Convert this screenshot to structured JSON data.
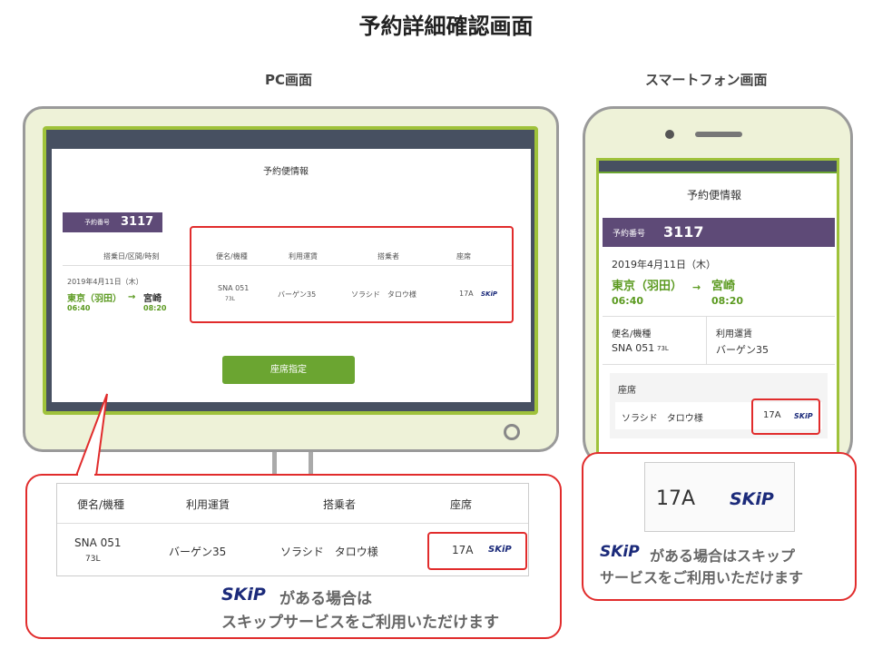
{
  "title": "予約詳細確認画面",
  "pc_heading": "PC画面",
  "sp_heading": "スマートフォン画面",
  "pc": {
    "screen_title": "予約便情報",
    "reservation_label": "予約番号",
    "reservation_number": "3117",
    "col_date": "搭乗日/区間/時刻",
    "col_flight": "便名/機種",
    "col_fare": "利用運賃",
    "col_passenger": "搭乗者",
    "col_seat": "座席",
    "date": "2019年4月11日（木）",
    "from": "東京（羽田）",
    "to": "宮崎",
    "dep_time": "06:40",
    "arr_time": "08:20",
    "flight": "SNA 051",
    "aircraft": "73L",
    "fare": "バーゲン35",
    "passenger": "ソラシド　タロウ様",
    "seat": "17A",
    "skip": "SKiP",
    "button": "座席指定"
  },
  "pc_zoom": {
    "col_flight": "便名/機種",
    "col_fare": "利用運賃",
    "col_passenger": "搭乗者",
    "col_seat": "座席",
    "flight": "SNA 051",
    "aircraft": "73L",
    "fare": "バーゲン35",
    "passenger": "ソラシド　タロウ様",
    "seat": "17A",
    "skip": "SKiP",
    "note_line1": "がある場合は",
    "note_line2": "スキップサービスをご利用いただけます"
  },
  "sp": {
    "screen_title": "予約便情報",
    "reservation_label": "予約番号",
    "reservation_number": "3117",
    "date": "2019年4月11日（木）",
    "from": "東京（羽田）",
    "to": "宮崎",
    "dep_time": "06:40",
    "arr_time": "08:20",
    "flight_label": "便名/機種",
    "flight": "SNA 051",
    "aircraft": "73L",
    "fare_label": "利用運賃",
    "fare": "バーゲン35",
    "seat_label": "座席",
    "passenger": "ソラシド　タロウ様",
    "seat": "17A",
    "skip": "SKiP"
  },
  "sp_zoom": {
    "seat": "17A",
    "skip": "SKiP",
    "note_line1": "がある場合はスキップ",
    "note_line2": "サービスをご利用いただけます"
  },
  "colors": {
    "accent_green": "#6ba531",
    "purple": "#5e4a77",
    "red": "#e12c2c",
    "skip_blue": "#1b2a7a"
  }
}
